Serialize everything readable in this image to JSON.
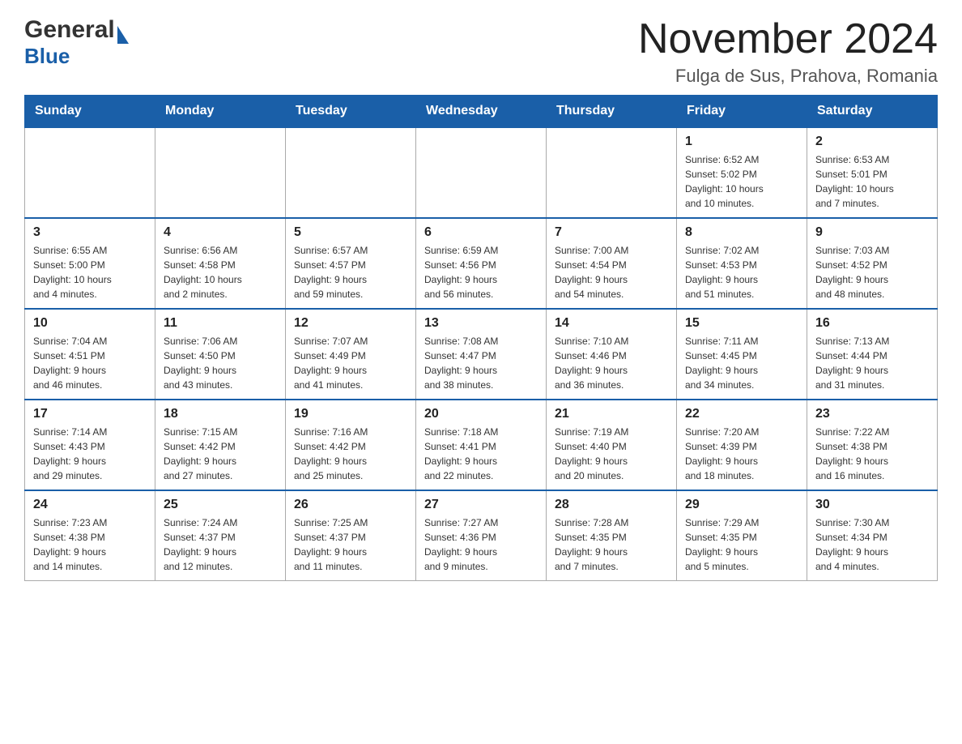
{
  "header": {
    "title": "November 2024",
    "subtitle": "Fulga de Sus, Prahova, Romania"
  },
  "logo": {
    "general": "General",
    "blue": "Blue"
  },
  "days_of_week": [
    "Sunday",
    "Monday",
    "Tuesday",
    "Wednesday",
    "Thursday",
    "Friday",
    "Saturday"
  ],
  "weeks": [
    [
      {
        "day": "",
        "info": ""
      },
      {
        "day": "",
        "info": ""
      },
      {
        "day": "",
        "info": ""
      },
      {
        "day": "",
        "info": ""
      },
      {
        "day": "",
        "info": ""
      },
      {
        "day": "1",
        "info": "Sunrise: 6:52 AM\nSunset: 5:02 PM\nDaylight: 10 hours\nand 10 minutes."
      },
      {
        "day": "2",
        "info": "Sunrise: 6:53 AM\nSunset: 5:01 PM\nDaylight: 10 hours\nand 7 minutes."
      }
    ],
    [
      {
        "day": "3",
        "info": "Sunrise: 6:55 AM\nSunset: 5:00 PM\nDaylight: 10 hours\nand 4 minutes."
      },
      {
        "day": "4",
        "info": "Sunrise: 6:56 AM\nSunset: 4:58 PM\nDaylight: 10 hours\nand 2 minutes."
      },
      {
        "day": "5",
        "info": "Sunrise: 6:57 AM\nSunset: 4:57 PM\nDaylight: 9 hours\nand 59 minutes."
      },
      {
        "day": "6",
        "info": "Sunrise: 6:59 AM\nSunset: 4:56 PM\nDaylight: 9 hours\nand 56 minutes."
      },
      {
        "day": "7",
        "info": "Sunrise: 7:00 AM\nSunset: 4:54 PM\nDaylight: 9 hours\nand 54 minutes."
      },
      {
        "day": "8",
        "info": "Sunrise: 7:02 AM\nSunset: 4:53 PM\nDaylight: 9 hours\nand 51 minutes."
      },
      {
        "day": "9",
        "info": "Sunrise: 7:03 AM\nSunset: 4:52 PM\nDaylight: 9 hours\nand 48 minutes."
      }
    ],
    [
      {
        "day": "10",
        "info": "Sunrise: 7:04 AM\nSunset: 4:51 PM\nDaylight: 9 hours\nand 46 minutes."
      },
      {
        "day": "11",
        "info": "Sunrise: 7:06 AM\nSunset: 4:50 PM\nDaylight: 9 hours\nand 43 minutes."
      },
      {
        "day": "12",
        "info": "Sunrise: 7:07 AM\nSunset: 4:49 PM\nDaylight: 9 hours\nand 41 minutes."
      },
      {
        "day": "13",
        "info": "Sunrise: 7:08 AM\nSunset: 4:47 PM\nDaylight: 9 hours\nand 38 minutes."
      },
      {
        "day": "14",
        "info": "Sunrise: 7:10 AM\nSunset: 4:46 PM\nDaylight: 9 hours\nand 36 minutes."
      },
      {
        "day": "15",
        "info": "Sunrise: 7:11 AM\nSunset: 4:45 PM\nDaylight: 9 hours\nand 34 minutes."
      },
      {
        "day": "16",
        "info": "Sunrise: 7:13 AM\nSunset: 4:44 PM\nDaylight: 9 hours\nand 31 minutes."
      }
    ],
    [
      {
        "day": "17",
        "info": "Sunrise: 7:14 AM\nSunset: 4:43 PM\nDaylight: 9 hours\nand 29 minutes."
      },
      {
        "day": "18",
        "info": "Sunrise: 7:15 AM\nSunset: 4:42 PM\nDaylight: 9 hours\nand 27 minutes."
      },
      {
        "day": "19",
        "info": "Sunrise: 7:16 AM\nSunset: 4:42 PM\nDaylight: 9 hours\nand 25 minutes."
      },
      {
        "day": "20",
        "info": "Sunrise: 7:18 AM\nSunset: 4:41 PM\nDaylight: 9 hours\nand 22 minutes."
      },
      {
        "day": "21",
        "info": "Sunrise: 7:19 AM\nSunset: 4:40 PM\nDaylight: 9 hours\nand 20 minutes."
      },
      {
        "day": "22",
        "info": "Sunrise: 7:20 AM\nSunset: 4:39 PM\nDaylight: 9 hours\nand 18 minutes."
      },
      {
        "day": "23",
        "info": "Sunrise: 7:22 AM\nSunset: 4:38 PM\nDaylight: 9 hours\nand 16 minutes."
      }
    ],
    [
      {
        "day": "24",
        "info": "Sunrise: 7:23 AM\nSunset: 4:38 PM\nDaylight: 9 hours\nand 14 minutes."
      },
      {
        "day": "25",
        "info": "Sunrise: 7:24 AM\nSunset: 4:37 PM\nDaylight: 9 hours\nand 12 minutes."
      },
      {
        "day": "26",
        "info": "Sunrise: 7:25 AM\nSunset: 4:37 PM\nDaylight: 9 hours\nand 11 minutes."
      },
      {
        "day": "27",
        "info": "Sunrise: 7:27 AM\nSunset: 4:36 PM\nDaylight: 9 hours\nand 9 minutes."
      },
      {
        "day": "28",
        "info": "Sunrise: 7:28 AM\nSunset: 4:35 PM\nDaylight: 9 hours\nand 7 minutes."
      },
      {
        "day": "29",
        "info": "Sunrise: 7:29 AM\nSunset: 4:35 PM\nDaylight: 9 hours\nand 5 minutes."
      },
      {
        "day": "30",
        "info": "Sunrise: 7:30 AM\nSunset: 4:34 PM\nDaylight: 9 hours\nand 4 minutes."
      }
    ]
  ]
}
